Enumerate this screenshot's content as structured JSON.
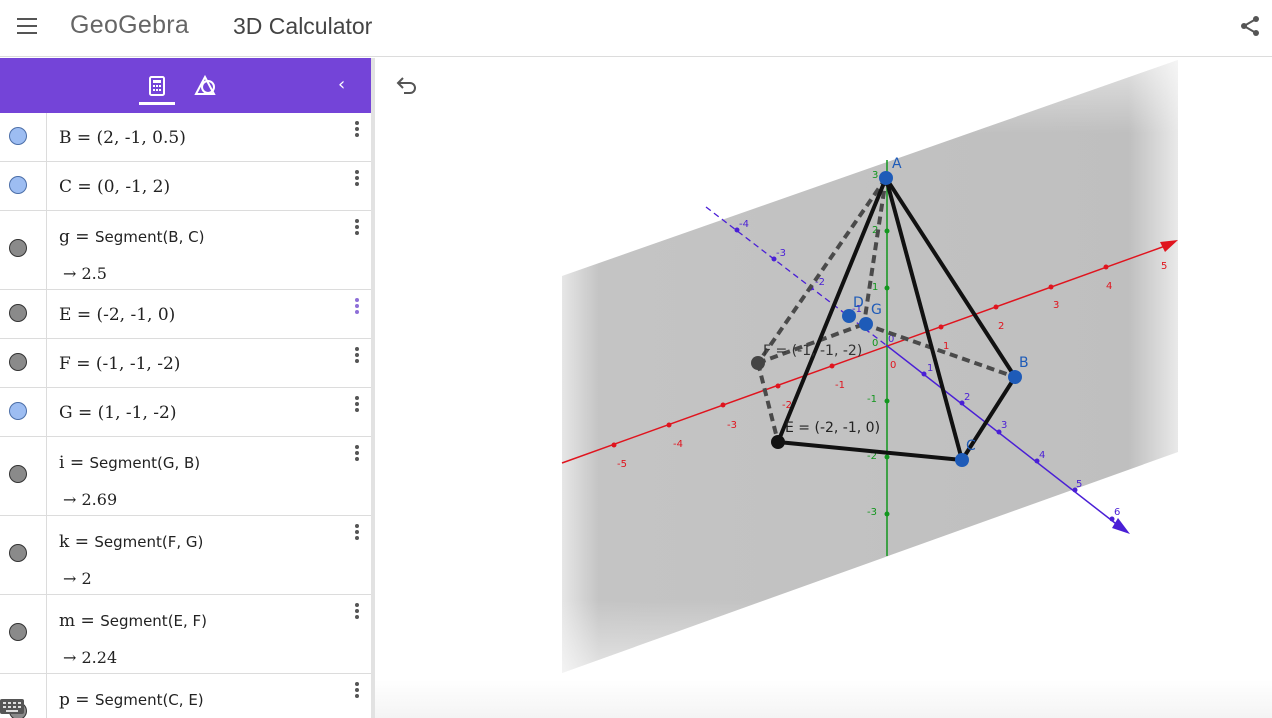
{
  "header": {
    "logo_text": "GeoGebra",
    "app_title": "3D Calculator",
    "icons": [
      "menu-icon",
      "share-icon"
    ]
  },
  "panel": {
    "accent": "#7444d8",
    "tabs": [
      "calculator-icon",
      "tools-icon"
    ],
    "collapse_label": "‹",
    "rows": [
      {
        "marble": "blue",
        "expr": "B = (2, -1, 0.5)"
      },
      {
        "marble": "blue",
        "expr": "C = (0, -1, 2)"
      },
      {
        "marble": "gray",
        "name": "g",
        "fn": "Segment(B, C)",
        "value": "2.5"
      },
      {
        "marble": "gray",
        "expr": "E = (-2, -1, 0)"
      },
      {
        "marble": "gray",
        "expr": "F = (-1, -1, -2)"
      },
      {
        "marble": "blue",
        "expr": "G = (1, -1, -2)"
      },
      {
        "marble": "gray",
        "name": "i",
        "fn": "Segment(G, B)",
        "value": "2.69"
      },
      {
        "marble": "gray",
        "name": "k",
        "fn": "Segment(F, G)",
        "value": "2"
      },
      {
        "marble": "gray",
        "name": "m",
        "fn": "Segment(E, F)",
        "value": "2.24"
      },
      {
        "marble": "gray",
        "name": "p",
        "fn": "Segment(C, E)",
        "value": ""
      }
    ]
  },
  "view3d": {
    "labels": {
      "A": "A",
      "B": "B",
      "C": "C",
      "D": "D",
      "G": "G",
      "E_full": "E = (-2, -1, 0)",
      "F_full": "F = (-1, -1, -2)"
    },
    "colors": {
      "x_axis": "#e0141e",
      "y_axis": "#4a1fd6",
      "z_axis": "#12961e",
      "point": "#1e5bb8"
    },
    "x_ticks": [
      "-5",
      "-4",
      "-3",
      "-2",
      "-1",
      "0",
      "1",
      "2",
      "3",
      "4",
      "5"
    ],
    "y_ticks": [
      "-4",
      "-3",
      "-2",
      "-1",
      "0",
      "1",
      "2",
      "3",
      "4",
      "5",
      "6"
    ],
    "z_ticks": [
      "-3",
      "-2",
      "-1",
      "0",
      "1",
      "2",
      "3"
    ]
  }
}
